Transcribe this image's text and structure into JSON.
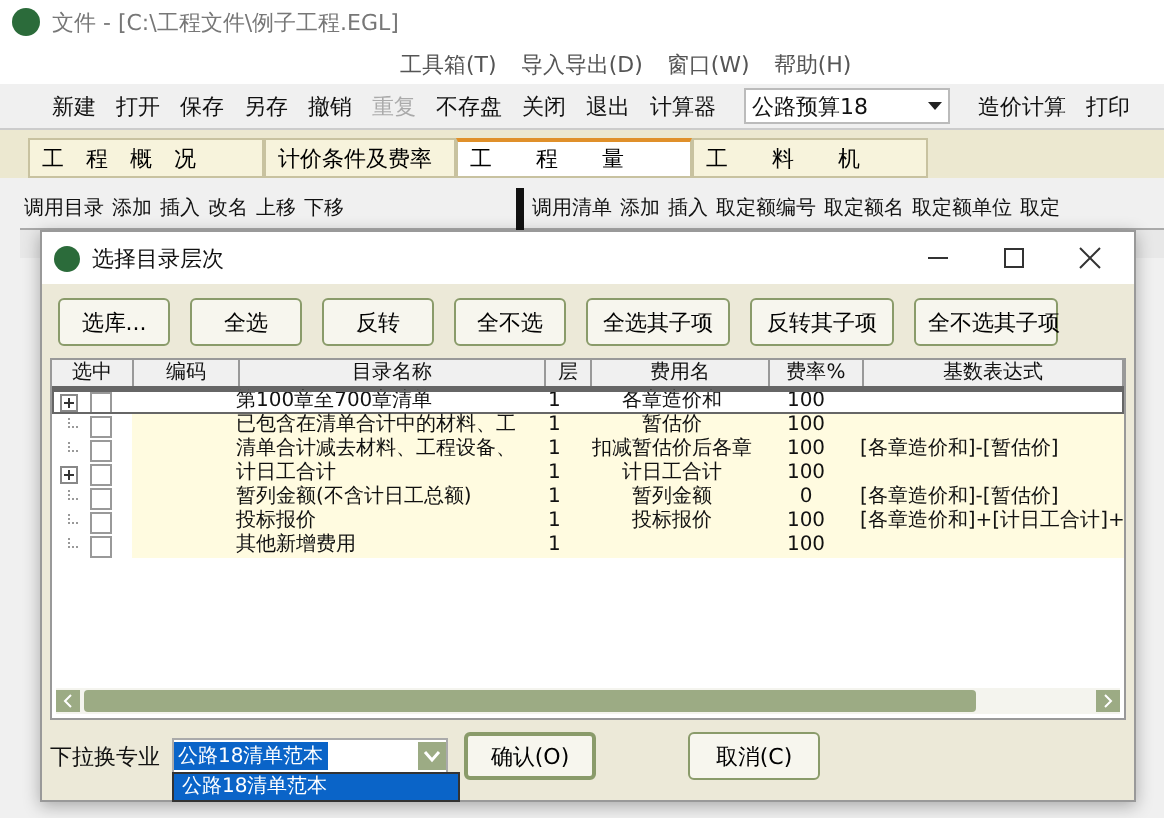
{
  "window": {
    "title": "文件 - [C:\\工程文件\\例子工程.EGL]"
  },
  "menu": [
    {
      "label": "工具箱(T)"
    },
    {
      "label": "导入导出(D)"
    },
    {
      "label": "窗口(W)"
    },
    {
      "label": "帮助(H)"
    }
  ],
  "toolbar": [
    {
      "label": "新建",
      "disabled": false
    },
    {
      "label": "打开",
      "disabled": false
    },
    {
      "label": "保存",
      "disabled": false
    },
    {
      "label": "另存",
      "disabled": false
    },
    {
      "label": "撤销",
      "disabled": false
    },
    {
      "label": "重复",
      "disabled": true
    },
    {
      "label": "不存盘",
      "disabled": false
    },
    {
      "label": "关闭",
      "disabled": false
    },
    {
      "label": "退出",
      "disabled": false
    },
    {
      "label": "计算器",
      "disabled": false
    }
  ],
  "toolbar_combo": {
    "value": "公路预算18"
  },
  "toolbar_right": [
    "造价计算",
    "打印"
  ],
  "tabs": [
    {
      "label": "工　程　概　况",
      "selected": false
    },
    {
      "label": "计价条件及费率",
      "selected": false
    },
    {
      "label": "工　　程　　量",
      "selected": true
    },
    {
      "label": "工　　料　　机",
      "selected": false
    }
  ],
  "left_toolbar": [
    "调用目录",
    "添加",
    "插入",
    "改名",
    "上移",
    "下移"
  ],
  "right_toolbar": [
    "调用清单",
    "添加",
    "插入",
    "取定额编号",
    "取定额名",
    "取定额单位",
    "取定"
  ],
  "dialog": {
    "title": "选择目录层次",
    "buttons": [
      "选库...",
      "全选",
      "反转",
      "全不选",
      "全选其子项",
      "反转其子项",
      "全不选其子项"
    ],
    "columns": [
      "选中",
      "编码",
      "目录名称",
      "层",
      "费用名",
      "费率%",
      "基数表达式"
    ],
    "rows": [
      {
        "expandable": true,
        "checked": false,
        "selected": true,
        "name": "第100章至700章清单",
        "level_text": "1",
        "fee": "各章造价和",
        "rate": "100",
        "expr": ""
      },
      {
        "expandable": false,
        "checked": false,
        "selected": false,
        "name": "已包含在清单合计中的材料、工",
        "level_text": "1",
        "fee": "暂估价",
        "rate": "100",
        "expr": ""
      },
      {
        "expandable": false,
        "checked": false,
        "selected": false,
        "name": "清单合计减去材料、工程设备、",
        "level_text": "1",
        "fee": "扣减暂估价后各章",
        "rate": "100",
        "expr": "[各章造价和]-[暂估价]"
      },
      {
        "expandable": true,
        "checked": false,
        "selected": false,
        "name": "计日工合计",
        "level_text": "1",
        "fee": "计日工合计",
        "rate": "100",
        "expr": ""
      },
      {
        "expandable": false,
        "checked": false,
        "selected": false,
        "name": "暂列金额(不含计日工总额)",
        "level_text": "1",
        "fee": "暂列金额",
        "rate": "0",
        "expr": "[各章造价和]-[暂估价]"
      },
      {
        "expandable": false,
        "checked": false,
        "selected": false,
        "name": "投标报价",
        "level_text": "1",
        "fee": "投标报价",
        "rate": "100",
        "expr": "[各章造价和]+[计日工合计]+"
      },
      {
        "expandable": false,
        "checked": false,
        "selected": false,
        "name": "其他新增费用",
        "level_text": "1",
        "fee": "",
        "rate": "100",
        "expr": ""
      }
    ],
    "specialty_label": "下拉换专业",
    "specialty_combo": {
      "value": "公路18清单范本"
    },
    "specialty_options": [
      {
        "label": "公路18清单范本",
        "selected": true
      }
    ],
    "ok": "确认(O)",
    "cancel": "取消(C)"
  }
}
